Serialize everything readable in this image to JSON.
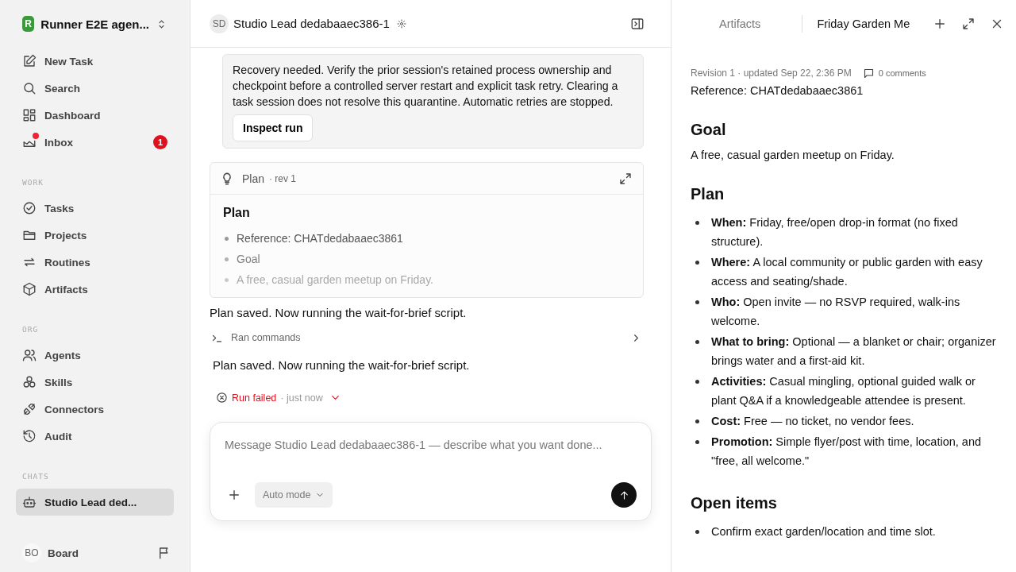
{
  "workspace": {
    "initial": "R",
    "name": "Runner E2E agen..."
  },
  "nav": [
    {
      "label": "New Task"
    },
    {
      "label": "Search"
    },
    {
      "label": "Dashboard"
    },
    {
      "label": "Inbox",
      "badge": "1",
      "unread": true
    }
  ],
  "sections": [
    {
      "title": "WORK",
      "items": [
        {
          "label": "Tasks"
        },
        {
          "label": "Projects"
        },
        {
          "label": "Routines"
        },
        {
          "label": "Artifacts"
        }
      ]
    },
    {
      "title": "ORG",
      "items": [
        {
          "label": "Agents"
        },
        {
          "label": "Skills"
        },
        {
          "label": "Connectors"
        },
        {
          "label": "Audit"
        }
      ]
    },
    {
      "title": "CHATS",
      "items": [
        {
          "label": "Studio Lead ded...",
          "selected": true
        }
      ]
    }
  ],
  "user": {
    "initials": "BO",
    "name": "Board"
  },
  "chat": {
    "avatar": "SD",
    "title": "Studio Lead dedabaaec386-1",
    "notice": {
      "text": "Recovery needed. Verify the prior session's retained process ownership and checkpoint before a controlled server restart and explicit task retry. Clearing a task session does not resolve this quarantine. Automatic retries are stopped.",
      "button": "Inspect run"
    },
    "plan_card": {
      "title": "Plan",
      "rev": "· rev 1",
      "heading": "Plan",
      "items": [
        "Reference: CHATdedabaaec3861",
        "Goal",
        "A free, casual garden meetup on Friday."
      ]
    },
    "message_1": "Plan saved. Now running the wait-for-brief script.",
    "commands": {
      "label": "Ran commands",
      "expanded": false
    },
    "message_2": "Plan saved. Now running the wait-for-brief script.",
    "status": {
      "label": "Run failed",
      "time": "· just now"
    },
    "composer": {
      "placeholder": "Message Studio Lead dedabaaec386-1 — describe what you want done...",
      "mode": "Auto mode"
    }
  },
  "panel": {
    "tabs": [
      {
        "label": "Artifacts",
        "selected": false
      },
      {
        "label": "Friday Garden Me",
        "selected": true
      }
    ],
    "meta": "Revision 1 · updated Sep 22, 2:36 PM",
    "comments": "0 comments",
    "reference": "Reference: CHATdedabaaec3861",
    "sections": [
      {
        "heading": "Goal",
        "paragraph": "A free, casual garden meetup on Friday."
      },
      {
        "heading": "Plan",
        "bullets": [
          "**When:** Friday, free/open drop-in format (no fixed structure).",
          "**Where:** A local community or public garden with easy access and seating/shade.",
          "**Who:** Open invite — no RSVP required, walk-ins welcome.",
          "**What to bring:** Optional — a blanket or chair; organizer brings water and a first-aid kit.",
          "**Activities:** Casual mingling, optional guided walk or plant Q&A if a knowledgeable attendee is present.",
          "**Cost:** Free — no ticket, no vendor fees.",
          "**Promotion:** Simple flyer/post with time, location, and \"free, all welcome.\""
        ]
      },
      {
        "heading": "Open items",
        "bullets": [
          "Confirm exact garden/location and time slot."
        ]
      }
    ]
  }
}
